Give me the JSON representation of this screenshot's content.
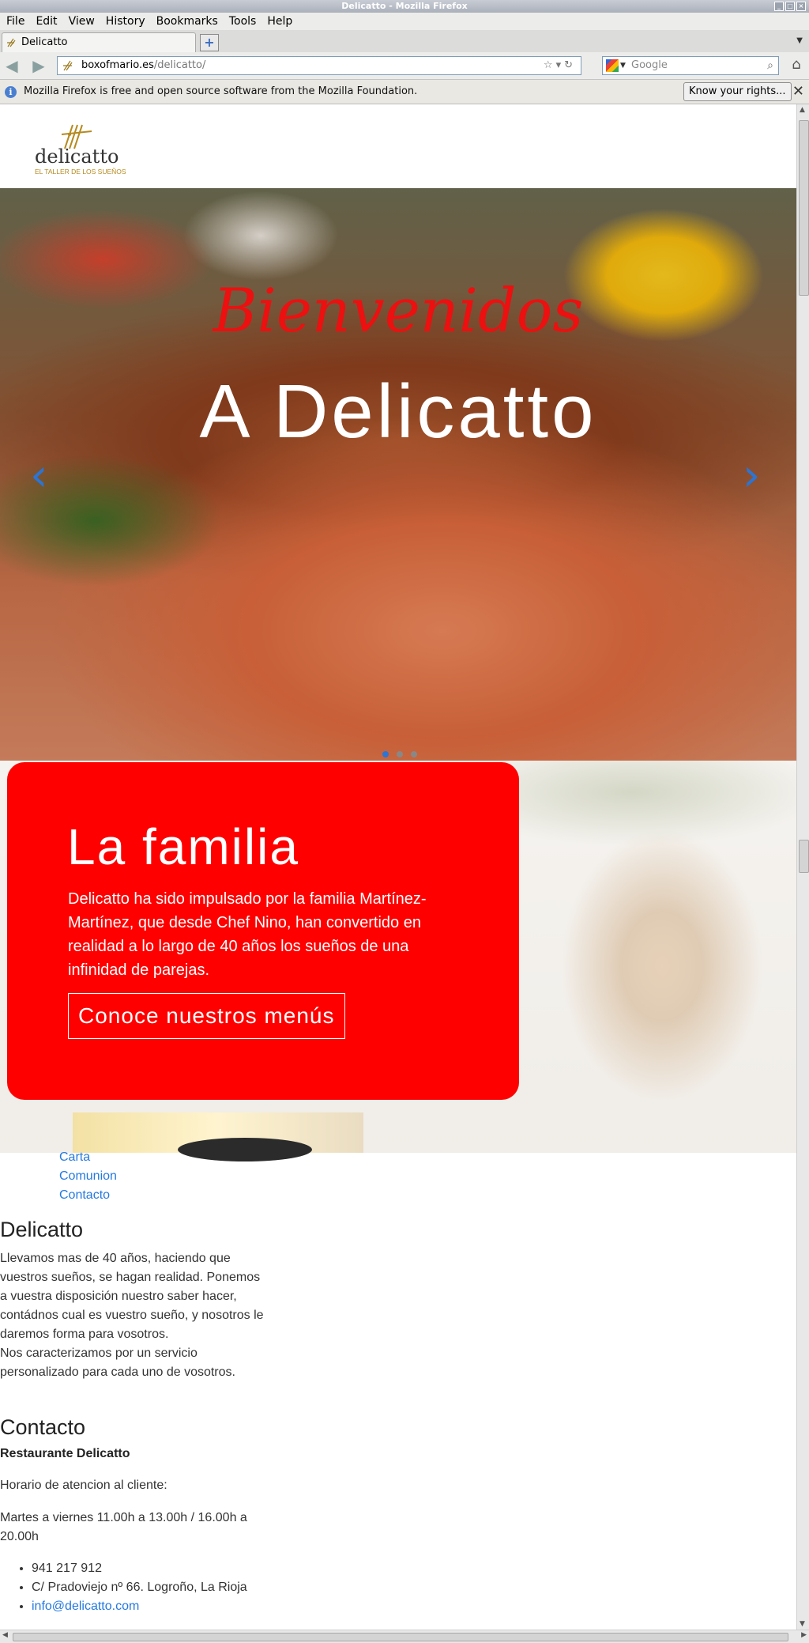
{
  "window": {
    "title": "Delicatto - Mozilla Firefox"
  },
  "menu": [
    "File",
    "Edit",
    "View",
    "History",
    "Bookmarks",
    "Tools",
    "Help"
  ],
  "tab": {
    "label": "Delicatto"
  },
  "urlbar": {
    "host": "boxofmario.es",
    "path": "/delicatto/"
  },
  "search": {
    "placeholder": "Google"
  },
  "infobar": {
    "message": "Mozilla Firefox is free and open source software from the Mozilla Foundation.",
    "button": "Know your rights..."
  },
  "logo": {
    "name": "delicatto",
    "tagline": "EL TALLER DE LOS SUEÑOS"
  },
  "hero": {
    "subtitle": "Bienvenidos",
    "title": "A Delicatto",
    "slides": 3,
    "active_slide": 1
  },
  "family": {
    "title": "La familia",
    "text": "Delicatto ha sido impulsado por la familia Martínez-Martínez, que desde Chef Nino, han convertido en realidad a lo largo de 40 años los sueños de una infinidad de parejas.",
    "cta": "Conoce nuestros menús"
  },
  "links": [
    "Carta",
    "Comunion",
    "Contacto"
  ],
  "about": {
    "title": "Delicatto",
    "text": "Llevamos mas de 40 años, haciendo que vuestros sueños, se hagan realidad. Ponemos a vuestra disposición nuestro saber hacer, contádnos cual es vuestro sueño, y nosotros le daremos forma para vosotros.",
    "text2": "Nos caracterizamos por un servicio personalizado para cada uno de vosotros."
  },
  "contact": {
    "title": "Contacto",
    "name": "Restaurante Delicatto",
    "hours_label": "Horario de atencion al cliente:",
    "hours": "Martes a viernes 11.00h a 13.00h / 16.00h a 20.00h",
    "phone": "941 217 912",
    "address": "C/ Pradoviejo nº 66. Logroño, La Rioja",
    "email": "info@delicatto.com"
  },
  "colors": {
    "brand_red": "#fe0000",
    "link_blue": "#2479e0",
    "logo_gold": "#b58a1e"
  }
}
